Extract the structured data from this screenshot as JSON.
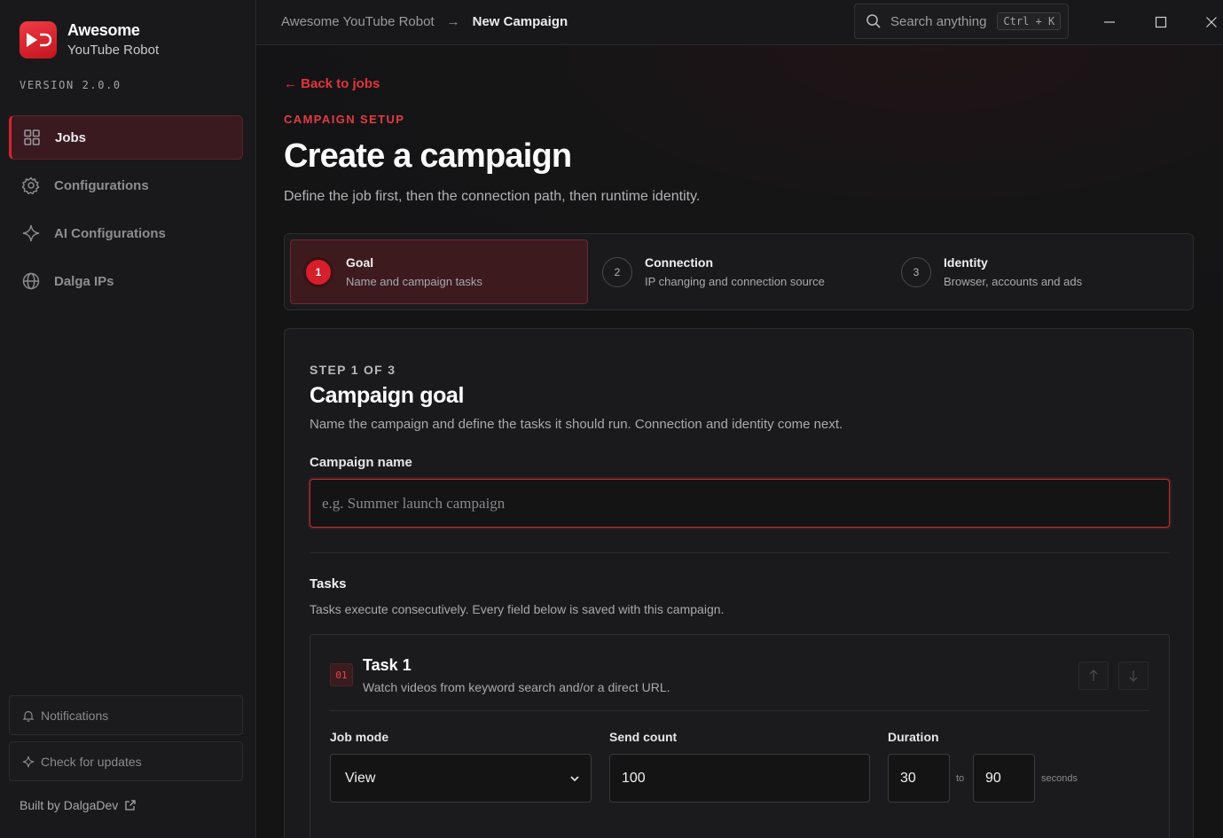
{
  "brand": {
    "title": "Awesome",
    "subtitle": "YouTube Robot",
    "version": "VERSION 2.0.0"
  },
  "nav": [
    {
      "label": "Jobs",
      "icon": "grid-icon",
      "active": true
    },
    {
      "label": "Configurations",
      "icon": "gear-icon",
      "active": false
    },
    {
      "label": "AI Configurations",
      "icon": "sparkle-icon",
      "active": false
    },
    {
      "label": "Dalga IPs",
      "icon": "globe-icon",
      "active": false
    }
  ],
  "sidebar_footer": {
    "notifications": "Notifications",
    "check_updates": "Check for updates",
    "built_by": "Built by DalgaDev"
  },
  "topbar": {
    "breadcrumb_root": "Awesome YouTube Robot",
    "breadcrumb_current": "New Campaign",
    "search_placeholder": "Search anything",
    "search_shortcut": "Ctrl + K"
  },
  "page": {
    "back_link": "← Back to jobs",
    "eyebrow": "CAMPAIGN SETUP",
    "title": "Create a campaign",
    "subtitle": "Define the job first, then the connection path, then runtime identity."
  },
  "steps": [
    {
      "number": "1",
      "title": "Goal",
      "description": "Name and campaign tasks",
      "active": true
    },
    {
      "number": "2",
      "title": "Connection",
      "description": "IP changing and connection source",
      "active": false
    },
    {
      "number": "3",
      "title": "Identity",
      "description": "Browser, accounts and ads",
      "active": false
    }
  ],
  "form": {
    "eyebrow": "STEP 1 OF 3",
    "title": "Campaign goal",
    "subtitle": "Name the campaign and define the tasks it should run. Connection and identity come next.",
    "campaign_name_label": "Campaign name",
    "campaign_name_value": "",
    "campaign_name_placeholder": "e.g. Summer launch campaign",
    "tasks_title": "Tasks",
    "tasks_subtitle": "Tasks execute consecutively. Every field below is saved with this campaign."
  },
  "task": {
    "badge": "01",
    "title": "Task 1",
    "subtitle": "Watch videos from keyword search and/or a direct URL.",
    "job_mode_label": "Job mode",
    "job_mode_value": "View",
    "send_count_label": "Send count",
    "send_count_value": "100",
    "duration_label": "Duration",
    "duration_min": "30",
    "duration_sep": "to",
    "duration_max": "90",
    "duration_unit": "seconds"
  },
  "colors": {
    "accent": "#d61f2b",
    "accent_text": "#e43a44",
    "background": "#141415",
    "sidebar": "#19191b"
  }
}
